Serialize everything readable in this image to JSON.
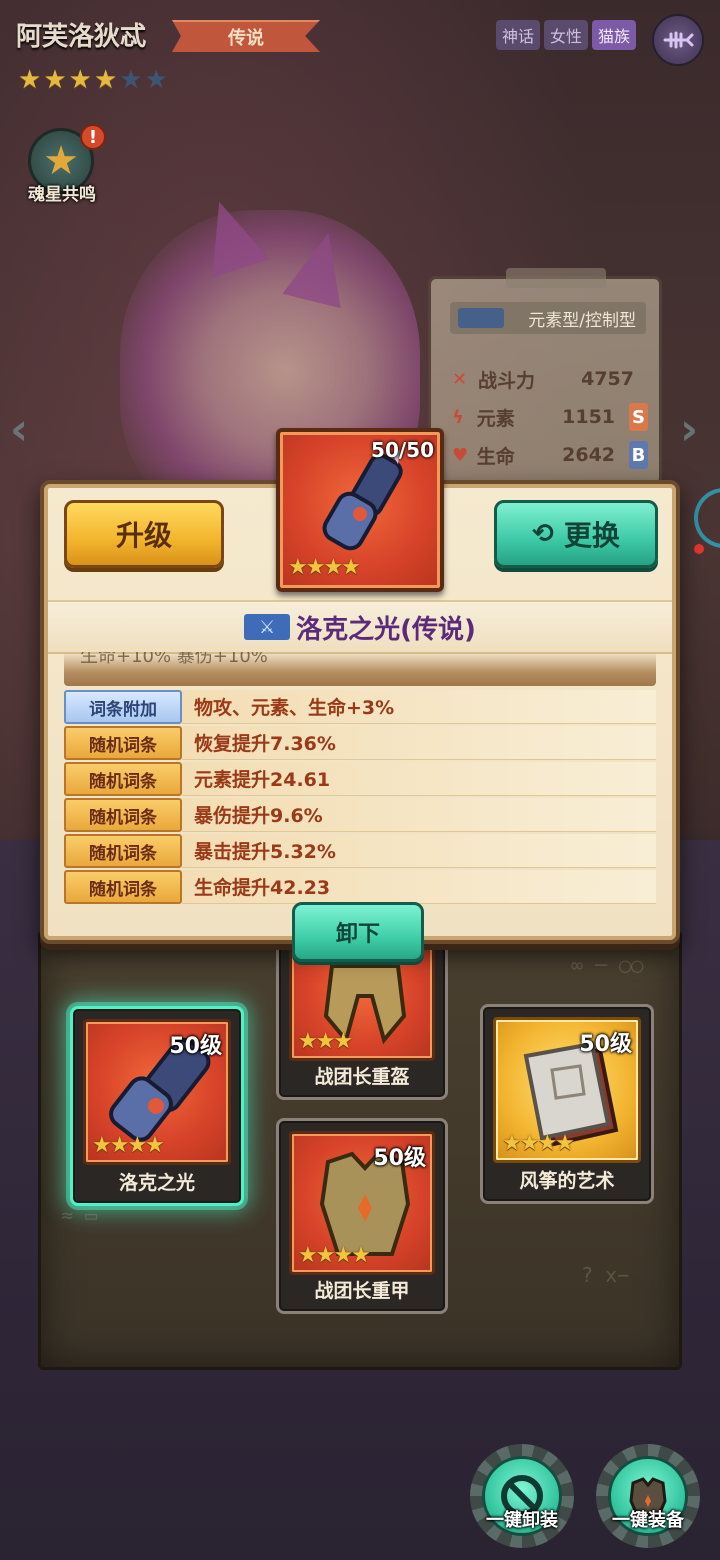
{
  "hero": {
    "name": "阿芙洛狄忒",
    "rarity": "传说",
    "stars_filled": 4,
    "stars_total": 6,
    "tags": [
      "神话",
      "女性",
      "猫族"
    ]
  },
  "soulstar": {
    "label": "魂星共鸣",
    "alert": "!"
  },
  "stats": {
    "type": "元素型/控制型",
    "rows": [
      {
        "name": "战斗力",
        "value": "4757",
        "grade": ""
      },
      {
        "name": "元素",
        "value": "1151",
        "grade": "S"
      },
      {
        "name": "生命",
        "value": "2642",
        "grade": "B"
      }
    ]
  },
  "popup": {
    "upgrade_label": "升级",
    "replace_label": "更换",
    "item_count": "50/50",
    "item_stars": "★★★★",
    "item_name": "洛克之光(传说)",
    "clipped_line": "生命+10%  暴伤+10%",
    "affixes": [
      {
        "key": "词条附加",
        "value": "物攻、元素、生命+3%",
        "style": "blue"
      },
      {
        "key": "随机词条",
        "value": "恢复提升7.36%",
        "style": "gold"
      },
      {
        "key": "随机词条",
        "value": "元素提升24.61",
        "style": "gold"
      },
      {
        "key": "随机词条",
        "value": "暴伤提升9.6%",
        "style": "gold"
      },
      {
        "key": "随机词条",
        "value": "暴击提升5.32%",
        "style": "gold"
      },
      {
        "key": "随机词条",
        "value": "生命提升42.23",
        "style": "gold"
      }
    ],
    "unequip_label": "卸下"
  },
  "slots": {
    "weapon": {
      "level": "50级",
      "stars": "★★★★",
      "name": "洛克之光"
    },
    "helmet": {
      "stars": "★★★",
      "name": "战团长重盔"
    },
    "armor": {
      "level": "50级",
      "stars": "★★★★",
      "name": "战团长重甲"
    },
    "book": {
      "level": "50级",
      "stars": "★★★★",
      "name": "风筝的艺术"
    }
  },
  "actions": {
    "unequip_all": "一键卸装",
    "equip_all": "一键装备"
  },
  "colors": {
    "accent_teal": "#3cc9a6",
    "accent_gold": "#f3b52d",
    "item_red": "#d8442a",
    "item_name_purple": "#5b2a7a"
  }
}
